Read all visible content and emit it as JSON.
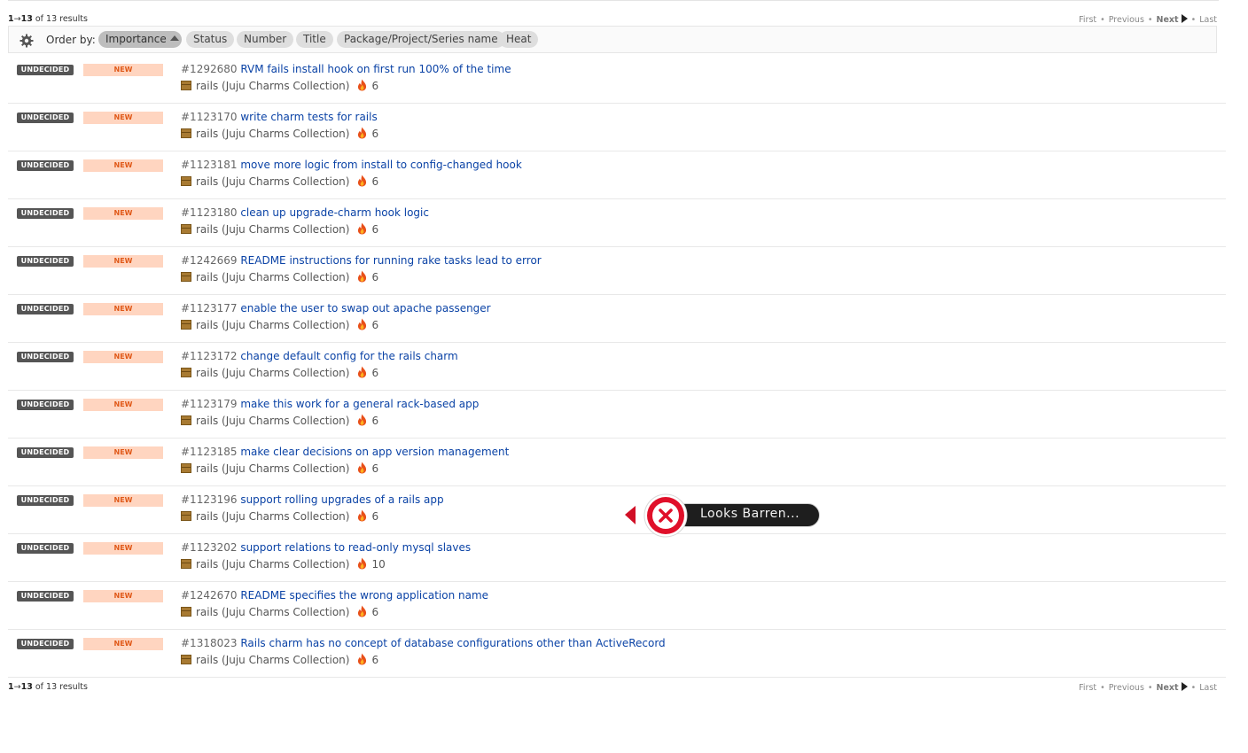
{
  "pager": {
    "range_start": "1",
    "arrow": "→",
    "range_end": "13",
    "of_text": "of 13 results",
    "first": "First",
    "previous": "Previous",
    "next": "Next",
    "last": "Last",
    "separator": "•"
  },
  "order_bar": {
    "label": "Order by:",
    "options": [
      "Importance",
      "Status",
      "Number",
      "Title",
      "Package/Project/Series name",
      "Heat"
    ],
    "active": "Importance"
  },
  "bugs": [
    {
      "importance": "UNDECIDED",
      "status": "NEW",
      "number": "#1292680",
      "title": "RVM fails install hook on first run 100% of the time",
      "package": "rails (Juju Charms Collection)",
      "heat": "6"
    },
    {
      "importance": "UNDECIDED",
      "status": "NEW",
      "number": "#1123170",
      "title": "write charm tests for rails",
      "package": "rails (Juju Charms Collection)",
      "heat": "6"
    },
    {
      "importance": "UNDECIDED",
      "status": "NEW",
      "number": "#1123181",
      "title": "move more logic from install to config-changed hook",
      "package": "rails (Juju Charms Collection)",
      "heat": "6"
    },
    {
      "importance": "UNDECIDED",
      "status": "NEW",
      "number": "#1123180",
      "title": "clean up upgrade-charm hook logic",
      "package": "rails (Juju Charms Collection)",
      "heat": "6"
    },
    {
      "importance": "UNDECIDED",
      "status": "NEW",
      "number": "#1242669",
      "title": "README instructions for running rake tasks lead to error",
      "package": "rails (Juju Charms Collection)",
      "heat": "6"
    },
    {
      "importance": "UNDECIDED",
      "status": "NEW",
      "number": "#1123177",
      "title": "enable the user to swap out apache passenger",
      "package": "rails (Juju Charms Collection)",
      "heat": "6"
    },
    {
      "importance": "UNDECIDED",
      "status": "NEW",
      "number": "#1123172",
      "title": "change default config for the rails charm",
      "package": "rails (Juju Charms Collection)",
      "heat": "6"
    },
    {
      "importance": "UNDECIDED",
      "status": "NEW",
      "number": "#1123179",
      "title": "make this work for a general rack-based app",
      "package": "rails (Juju Charms Collection)",
      "heat": "6"
    },
    {
      "importance": "UNDECIDED",
      "status": "NEW",
      "number": "#1123185",
      "title": "make clear decisions on app version management",
      "package": "rails (Juju Charms Collection)",
      "heat": "6"
    },
    {
      "importance": "UNDECIDED",
      "status": "NEW",
      "number": "#1123196",
      "title": "support rolling upgrades of a rails app",
      "package": "rails (Juju Charms Collection)",
      "heat": "6"
    },
    {
      "importance": "UNDECIDED",
      "status": "NEW",
      "number": "#1123202",
      "title": "support relations to read-only mysql slaves",
      "package": "rails (Juju Charms Collection)",
      "heat": "10"
    },
    {
      "importance": "UNDECIDED",
      "status": "NEW",
      "number": "#1242670",
      "title": "README specifies the wrong application name",
      "package": "rails (Juju Charms Collection)",
      "heat": "6"
    },
    {
      "importance": "UNDECIDED",
      "status": "NEW",
      "number": "#1318023",
      "title": "Rails charm has no concept of database configurations other than ActiveRecord",
      "package": "rails (Juju Charms Collection)",
      "heat": "6"
    }
  ],
  "toast": {
    "text": "Looks Barren...",
    "icon": "close-x-icon",
    "color": "#e0102a"
  },
  "colors": {
    "link": "#0b43a6",
    "importance_badge": "#555555",
    "status_badge_bg": "#ffd5c0",
    "status_badge_text": "#e05a1a"
  }
}
